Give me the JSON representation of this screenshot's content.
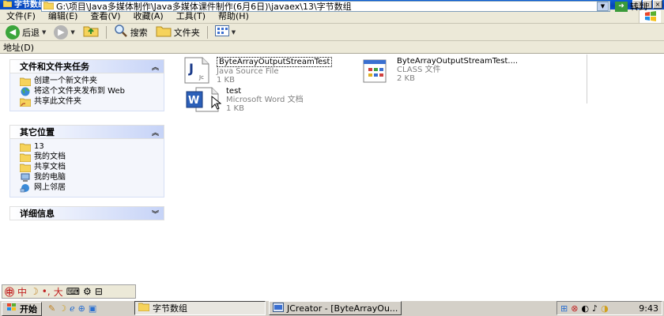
{
  "window": {
    "title": "字节数组"
  },
  "menu": [
    {
      "label": "文件(F)"
    },
    {
      "label": "编辑(E)"
    },
    {
      "label": "查看(V)"
    },
    {
      "label": "收藏(A)"
    },
    {
      "label": "工具(T)"
    },
    {
      "label": "帮助(H)"
    }
  ],
  "toolbar": {
    "back_label": "后退",
    "search_label": "搜索",
    "folders_label": "文件夹"
  },
  "address": {
    "label": "地址(D)",
    "path": "G:\\项目\\Java多媒体制作\\Java多媒体课件制作(6月6日)\\javaex\\13\\字节数组",
    "go_label": "转到"
  },
  "left_panel": {
    "file_tasks": {
      "title": "文件和文件夹任务",
      "items": [
        {
          "label": "创建一个新文件夹",
          "icon": "new-folder-icon"
        },
        {
          "label": "将这个文件夹发布到 Web",
          "icon": "globe-icon"
        },
        {
          "label": "共享此文件夹",
          "icon": "share-folder-icon"
        }
      ]
    },
    "other_places": {
      "title": "其它位置",
      "items": [
        {
          "label": "13",
          "icon": "folder-icon"
        },
        {
          "label": "我的文档",
          "icon": "folder-icon"
        },
        {
          "label": "共享文档",
          "icon": "folder-icon"
        },
        {
          "label": "我的电脑",
          "icon": "computer-icon"
        },
        {
          "label": "网上邻居",
          "icon": "network-icon"
        }
      ]
    },
    "details": {
      "title": "详细信息"
    }
  },
  "files": [
    {
      "name": "ByteArrayOutputStreamTest",
      "type": "Java Source File",
      "size": "1 KB",
      "icon": "java-file-icon",
      "selected": true
    },
    {
      "name": "ByteArrayOutputStreamTest....",
      "type": "CLASS 文件",
      "size": "2 KB",
      "icon": "class-file-icon"
    },
    {
      "name": "test",
      "type": "Microsoft Word 文档",
      "size": "1 KB",
      "icon": "word-doc-icon"
    }
  ],
  "langbar": {
    "text": "中"
  },
  "taskbar": {
    "start_label": "开始",
    "tasks": [
      {
        "label": "字节数组",
        "active": true
      },
      {
        "label": "JCreator - [ByteArrayOu..."
      }
    ],
    "clock": "9:43"
  },
  "colors": {
    "titlebar": "#0a55d0",
    "panel_head": "#c6d3f7",
    "go_button": "#3a9a3a"
  }
}
